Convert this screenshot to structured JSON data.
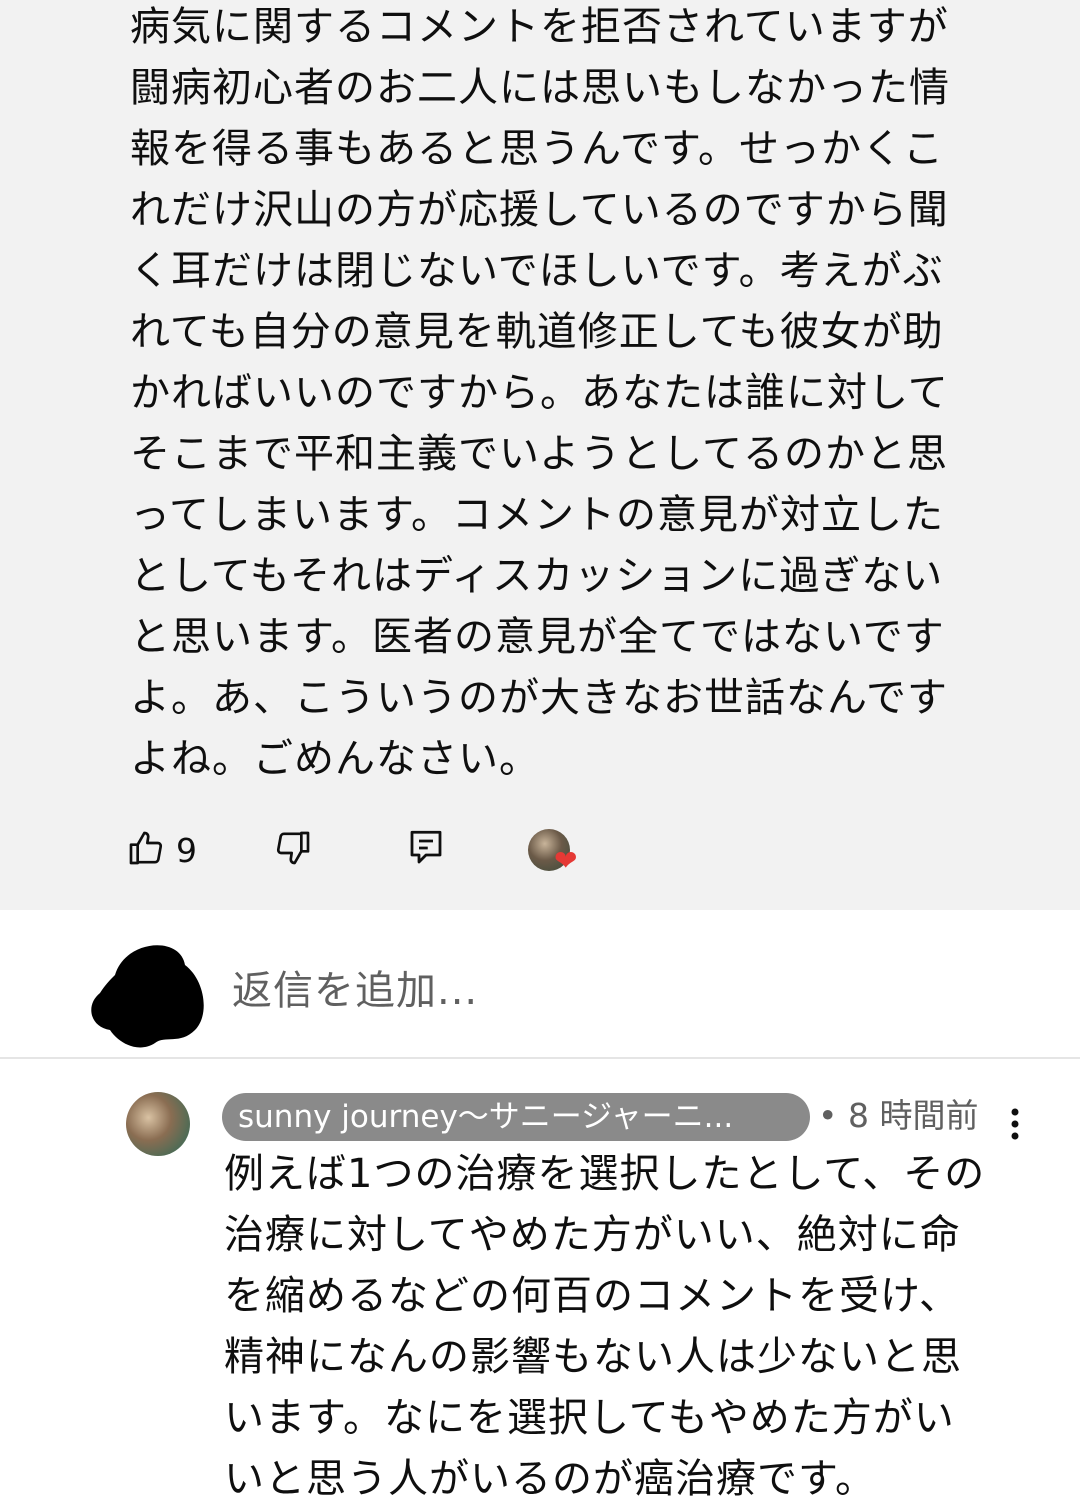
{
  "parent_comment": {
    "text": "病気に関するコメントを拒否されていますが\n闘病初心者のお二人には思いもしなかった情\n報を得る事もあると思うんです。せっかくこ\nれだけ沢山の方が応援しているのですから聞\nく耳だけは閉じないでほしいです。考えがぶ\nれても自分の意見を軌道修正しても彼女が助\nかればいいのですから。あなたは誰に対して\nそこまで平和主義でいようとしてるのかと思\nってしまいます。コメントの意見が対立した\nとしてもそれはディスカッションに過ぎない\nと思います。医者の意見が全てではないです\nよ。あ、こういうのが大きなお世話なんです\nよね。ごめんなさい。",
    "like_count": "9"
  },
  "add_reply": {
    "placeholder": "返信を追加..."
  },
  "reply": {
    "author": "sunny journey〜サニージャーニ...",
    "time": "• 8 時間前",
    "text": "例えば1つの治療を選択したとして、その\n治療に対してやめた方がいい、絶対に命\nを縮めるなどの何百のコメントを受け、\n精神になんの影響もない人は少ないと思\nいます。なにを選択してもやめた方がい\nいと思う人がいるのが癌治療です。"
  },
  "icons": {
    "like": "thumb-up-icon",
    "dislike": "thumb-down-icon",
    "reply": "comment-reply-icon",
    "heart": "creator-heart-icon",
    "more": "more-vert-icon"
  },
  "colors": {
    "comment_background": "#f2f2f2",
    "author_chip": "#8a8a8a",
    "heart": "#e53935"
  }
}
